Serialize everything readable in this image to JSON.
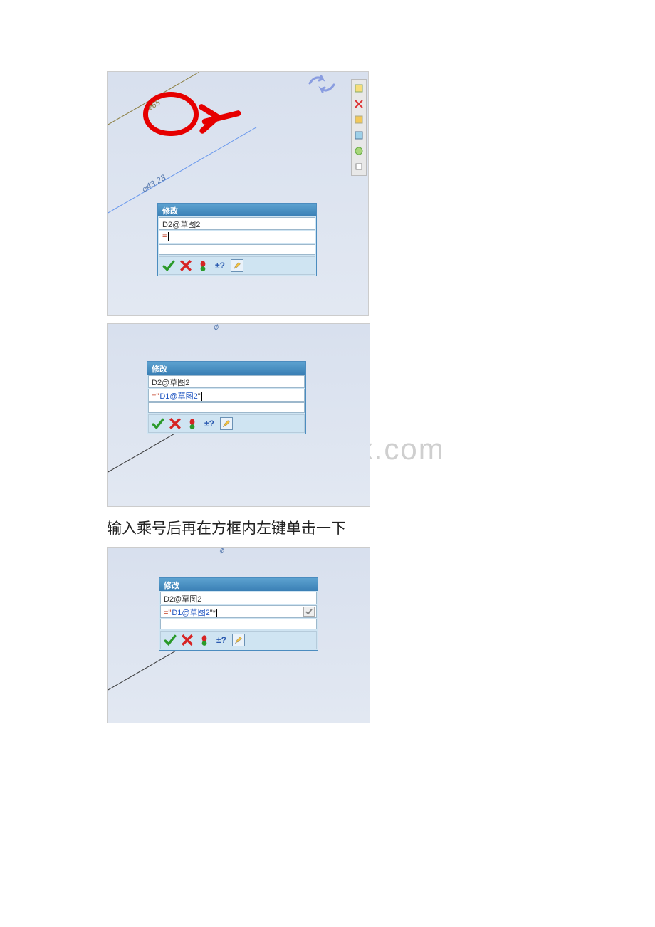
{
  "watermark": "www.bdocx.com",
  "body_text_1": "输入乘号后再在方框内左键单击一下",
  "dim1_label": "⌀65",
  "dim2_label": "⌀43.23",
  "dim3_label": "⌀",
  "dim4_label": "⌀",
  "dialog": {
    "title": "修改",
    "name_value": "D2@草图2"
  },
  "dialog1": {
    "expr": "="
  },
  "dialog2": {
    "expr_prefix": "=\"",
    "expr_ref": "D1@草图2",
    "expr_suffix": "\""
  },
  "dialog3": {
    "expr_prefix": "=\"",
    "expr_ref": "D1@草图2",
    "expr_suffix": "\"*"
  },
  "icons": {
    "check": "ok-icon",
    "x": "cancel-icon",
    "light": "rebuild-icon",
    "pm": "plus-minus-icon",
    "pencil": "edit-icon"
  }
}
